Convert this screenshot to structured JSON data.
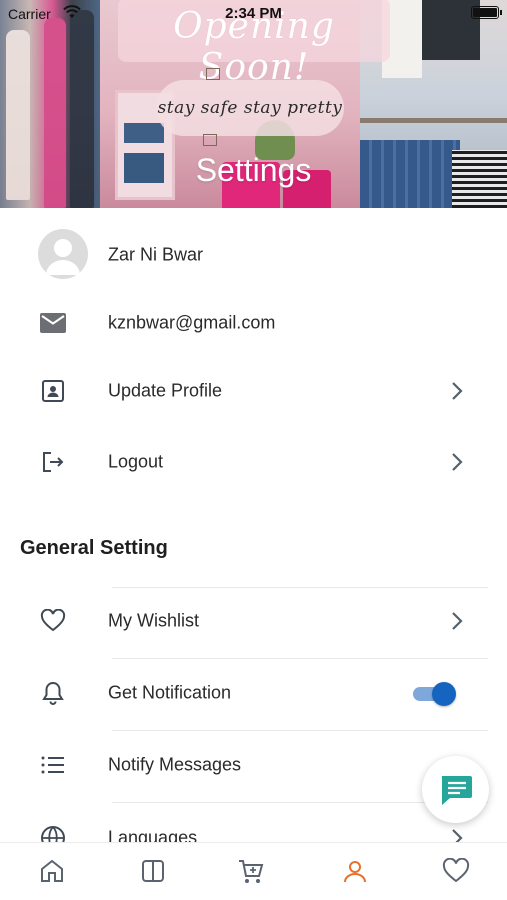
{
  "status_bar": {
    "carrier": "Carrier",
    "time": "2:34 PM"
  },
  "header": {
    "banner_text": "Opening Soon!",
    "banner_subtext": "stay safe stay pretty",
    "title": "Settings"
  },
  "profile": {
    "name": "Zar Ni Bwar",
    "email": "kznbwar@gmail.com",
    "update_label": "Update Profile",
    "logout_label": "Logout"
  },
  "general": {
    "section_title": "General Setting",
    "items": [
      {
        "label": "My Wishlist",
        "icon": "heart-icon"
      },
      {
        "label": "Get Notification",
        "icon": "bell-icon",
        "toggle_on": true
      },
      {
        "label": "Notify Messages",
        "icon": "list-icon"
      },
      {
        "label": "Languages",
        "icon": "globe-icon"
      }
    ]
  },
  "tabbar": {
    "tabs": [
      {
        "icon": "home-icon",
        "active": false
      },
      {
        "icon": "category-icon",
        "active": false
      },
      {
        "icon": "cart-icon",
        "active": false
      },
      {
        "icon": "profile-icon",
        "active": true
      },
      {
        "icon": "heart-icon",
        "active": false
      }
    ]
  },
  "colors": {
    "accent": "#e8702a",
    "toggle": "#1565c0",
    "chat_icon": "#26a69a",
    "icon_gray": "#5a6470"
  }
}
